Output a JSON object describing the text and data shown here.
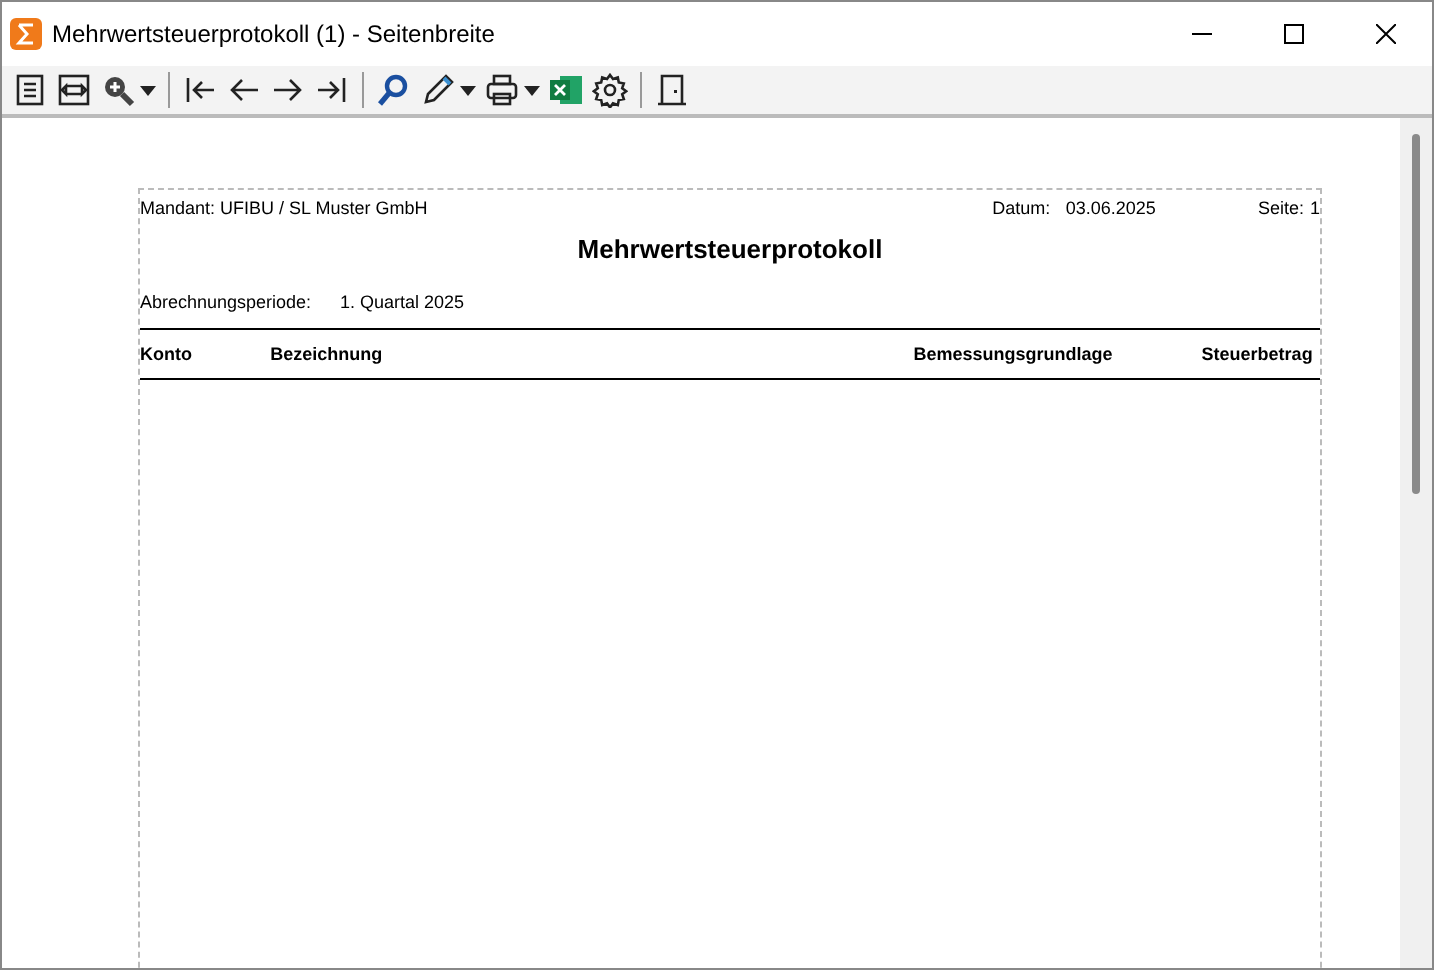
{
  "window": {
    "title": "Mehrwertsteuerprotokoll (1) - Seitenbreite"
  },
  "toolbar": [
    {
      "kind": "page",
      "dropdown": false
    },
    {
      "kind": "pagewidth",
      "dropdown": false
    },
    {
      "kind": "zoom",
      "dropdown": true
    },
    {
      "kind": "sep"
    },
    {
      "kind": "first",
      "dropdown": false
    },
    {
      "kind": "prev",
      "dropdown": false
    },
    {
      "kind": "next",
      "dropdown": false
    },
    {
      "kind": "last",
      "dropdown": false
    },
    {
      "kind": "sep"
    },
    {
      "kind": "search",
      "dropdown": false
    },
    {
      "kind": "pen",
      "dropdown": true
    },
    {
      "kind": "print",
      "dropdown": true
    },
    {
      "kind": "excel",
      "dropdown": false
    },
    {
      "kind": "settings",
      "dropdown": false
    },
    {
      "kind": "sep"
    },
    {
      "kind": "exit",
      "dropdown": false
    }
  ],
  "report": {
    "mandant": "Mandant: UFIBU / SL Muster GmbH",
    "datum_label": "Datum:",
    "datum": "03.06.2025",
    "seite_label": "Seite:",
    "seite": "1",
    "title": "Mehrwertsteuerprotokoll",
    "period_label": "Abrechnungsperiode:",
    "period": "1. Quartal 2025",
    "columns": [
      "Konto",
      "Bezeichnung",
      "Bemessungsgrundlage",
      "Steuerbetrag"
    ]
  }
}
